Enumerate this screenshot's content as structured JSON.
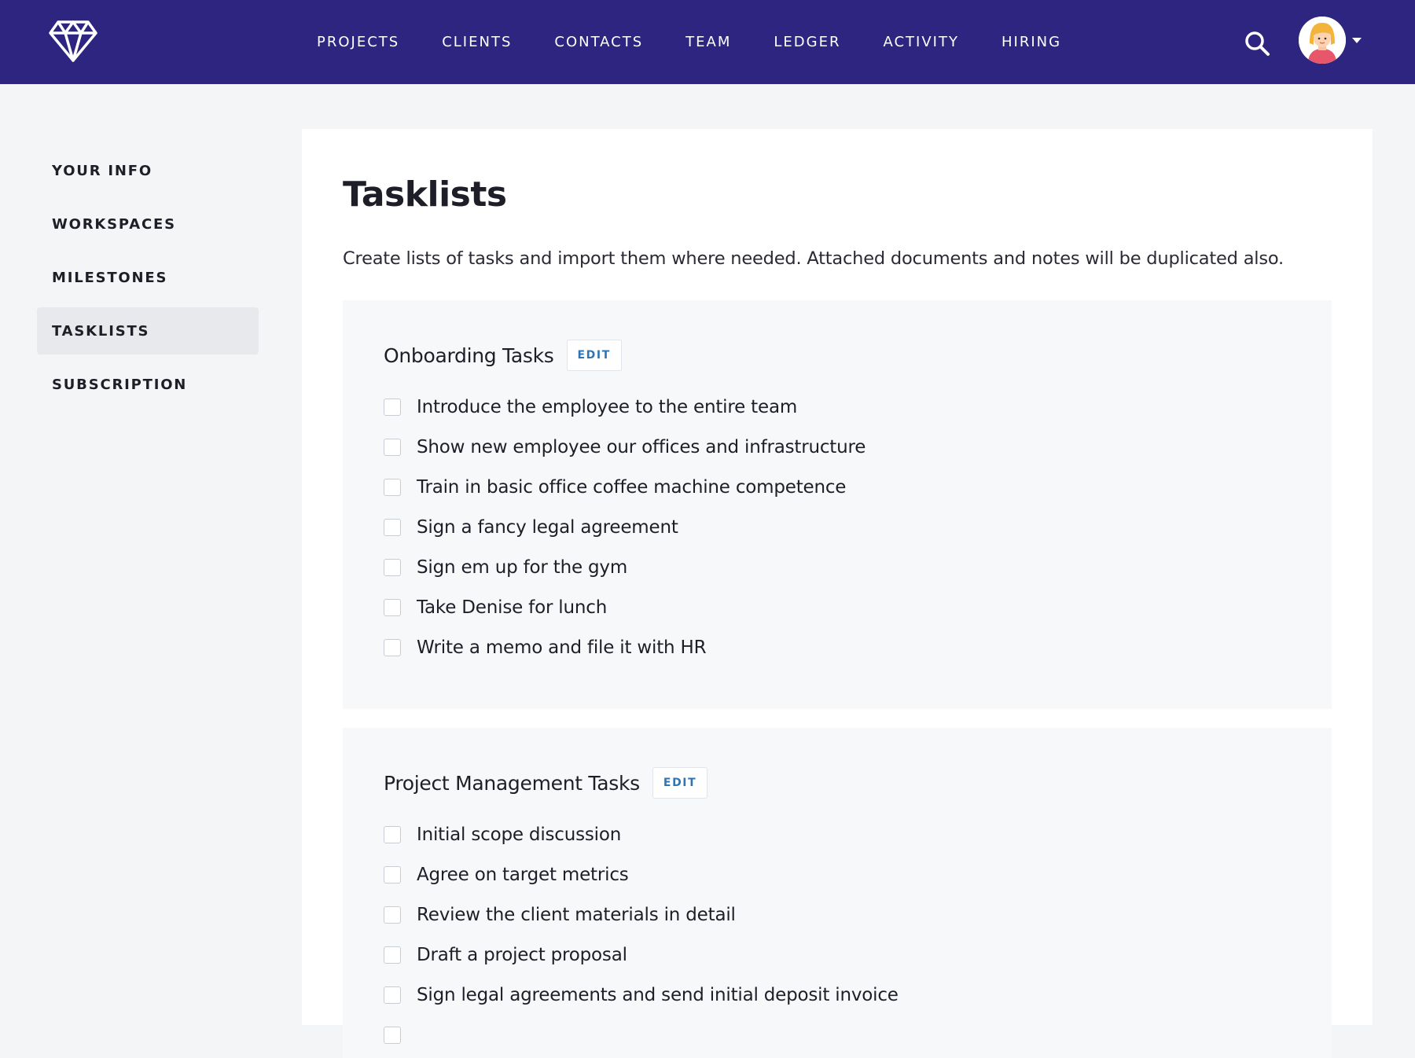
{
  "nav": {
    "items": [
      "PROJECTS",
      "CLIENTS",
      "CONTACTS",
      "TEAM",
      "LEDGER",
      "ACTIVITY",
      "HIRING"
    ],
    "icons": {
      "logo": "diamond-logo",
      "search": "search-icon",
      "account_menu": "chevron-down-icon"
    }
  },
  "sidebar": {
    "items": [
      {
        "label": "YOUR INFO",
        "active": false
      },
      {
        "label": "WORKSPACES",
        "active": false
      },
      {
        "label": "MILESTONES",
        "active": false
      },
      {
        "label": "TASKLISTS",
        "active": true
      },
      {
        "label": "SUBSCRIPTION",
        "active": false
      }
    ]
  },
  "main": {
    "title": "Tasklists",
    "description": "Create lists of tasks and import them where needed. Attached documents and notes will be duplicated also.",
    "tasklists": [
      {
        "title": "Onboarding Tasks",
        "edit_label": "EDIT",
        "tasks": [
          "Introduce the employee to the entire team",
          "Show new employee our offices and infrastructure",
          "Train in basic office coffee machine competence",
          "Sign a fancy legal agreement",
          "Sign em up for the gym",
          "Take Denise for lunch",
          "Write a memo and file it with HR"
        ]
      },
      {
        "title": "Project Management Tasks",
        "edit_label": "EDIT",
        "tasks": [
          "Initial scope discussion",
          "Agree on target metrics",
          "Review the client materials in detail",
          "Draft a project proposal",
          "Sign legal agreements and send initial deposit invoice"
        ]
      }
    ]
  },
  "colors": {
    "topbar": "#2d2580",
    "accent_link": "#2f75b5",
    "page_bg": "#f4f5f7",
    "card_bg": "#f7f8fa",
    "sidebar_active_bg": "#e8e9ec"
  }
}
